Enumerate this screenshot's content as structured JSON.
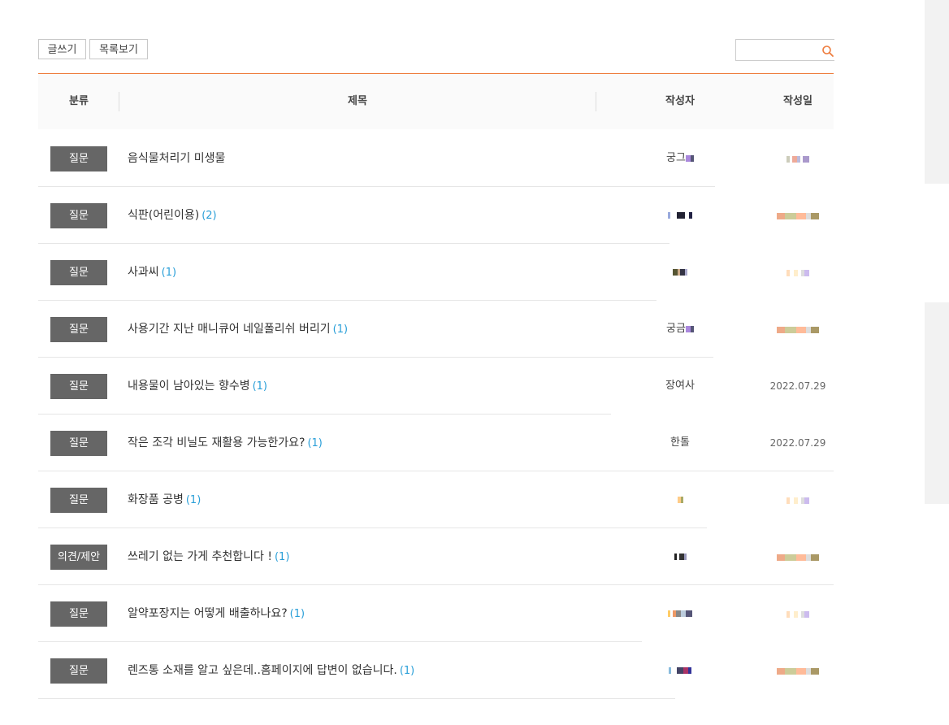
{
  "toolbar": {
    "write_label": "글쓰기",
    "list_label": "목록보기",
    "search_placeholder": "",
    "accent_color": "#ee7c3d"
  },
  "table": {
    "headers": {
      "category": "분류",
      "title": "제목",
      "author": "작성자",
      "date": "작성일"
    },
    "rows": [
      {
        "category": "질문",
        "title": "음식물처리기 미생물",
        "count": "",
        "author": "궁그",
        "date": ""
      },
      {
        "category": "질문",
        "title": "식판(어린이용)",
        "count": "(2)",
        "author": "",
        "date": ""
      },
      {
        "category": "질문",
        "title": "사과씨",
        "count": "(1)",
        "author": "",
        "date": ""
      },
      {
        "category": "질문",
        "title": "사용기간 지난 매니큐어 네일폴리쉬 버리기",
        "count": "(1)",
        "author": "궁금",
        "date": ""
      },
      {
        "category": "질문",
        "title": "내용물이 남아있는 향수병",
        "count": "(1)",
        "author": "장여사",
        "date": "2022.07.29"
      },
      {
        "category": "질문",
        "title": "작은 조각 비닐도 재활용 가능한가요?",
        "count": "(1)",
        "author": "한톨",
        "date": "2022.07.29"
      },
      {
        "category": "질문",
        "title": "화장품 공병",
        "count": "(1)",
        "author": "",
        "date": ""
      },
      {
        "category": "의견/제안",
        "title": "쓰레기 없는 가게 추천합니다 !",
        "count": "(1)",
        "author": "",
        "date": ""
      },
      {
        "category": "질문",
        "title": "알약포장지는 어떻게 배출하나요?",
        "count": "(1)",
        "author": "",
        "date": ""
      },
      {
        "category": "질문",
        "title": "렌즈통 소재를 알고 싶은데..홈페이지에 답변이 없습니다.",
        "count": "(1)",
        "author": "",
        "date": ""
      }
    ]
  }
}
